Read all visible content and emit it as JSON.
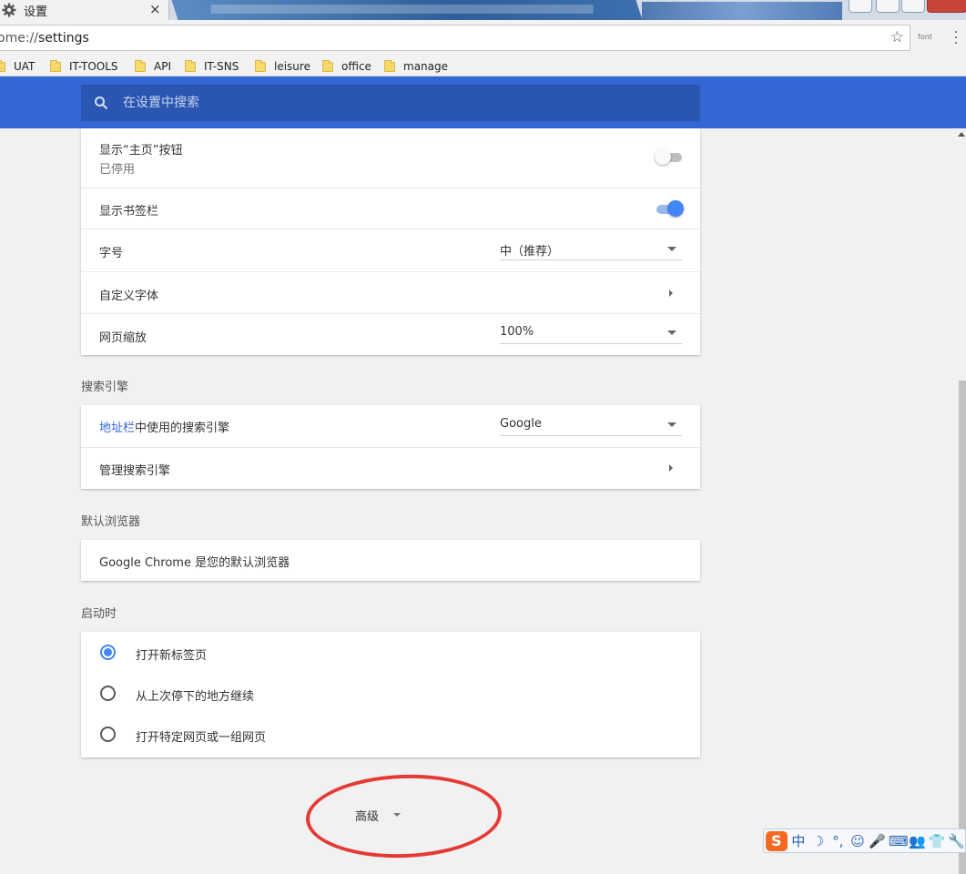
{
  "tab": {
    "title": "设置",
    "close": "×"
  },
  "omnibox": {
    "url_scheme": "ome://",
    "url_path": "settings",
    "star": "☆"
  },
  "extension": {
    "label": "font"
  },
  "bookmarks": [
    {
      "label": "UAT"
    },
    {
      "label": "IT-TOOLS"
    },
    {
      "label": "API"
    },
    {
      "label": "IT-SNS"
    },
    {
      "label": "leisure"
    },
    {
      "label": "office"
    },
    {
      "label": "manage"
    }
  ],
  "search": {
    "placeholder": "在设置中搜索"
  },
  "appearance": {
    "home_button": {
      "label": "显示“主页”按钮",
      "sub": "已停用",
      "enabled": false
    },
    "bookmarks_bar": {
      "label": "显示书签栏",
      "enabled": true
    },
    "font_size": {
      "label": "字号",
      "value": "中（推荐）"
    },
    "custom_fonts": {
      "label": "自定义字体"
    },
    "page_zoom": {
      "label": "网页缩放",
      "value": "100%"
    }
  },
  "search_engine": {
    "section_title": "搜索引擎",
    "address_bar": {
      "link": "地址栏",
      "label": "中使用的搜索引擎",
      "value": "Google"
    },
    "manage": {
      "label": "管理搜索引擎"
    }
  },
  "default_browser": {
    "section_title": "默认浏览器",
    "status": "Google Chrome 是您的默认浏览器"
  },
  "on_startup": {
    "section_title": "启动时",
    "options": [
      {
        "label": "打开新标签页",
        "checked": true
      },
      {
        "label": "从上次停下的地方继续",
        "checked": false
      },
      {
        "label": "打开特定网页或一组网页",
        "checked": false
      }
    ]
  },
  "advanced": {
    "label": "高级"
  },
  "ime": {
    "logo": "S",
    "lang": "中",
    "items": [
      "☽",
      "°,",
      "☺",
      "🎤",
      "⌨",
      "👥",
      "👕",
      "🔧"
    ]
  },
  "colors": {
    "header": "#3367d6",
    "accent": "#4285f4",
    "annotation": "#e53935"
  }
}
